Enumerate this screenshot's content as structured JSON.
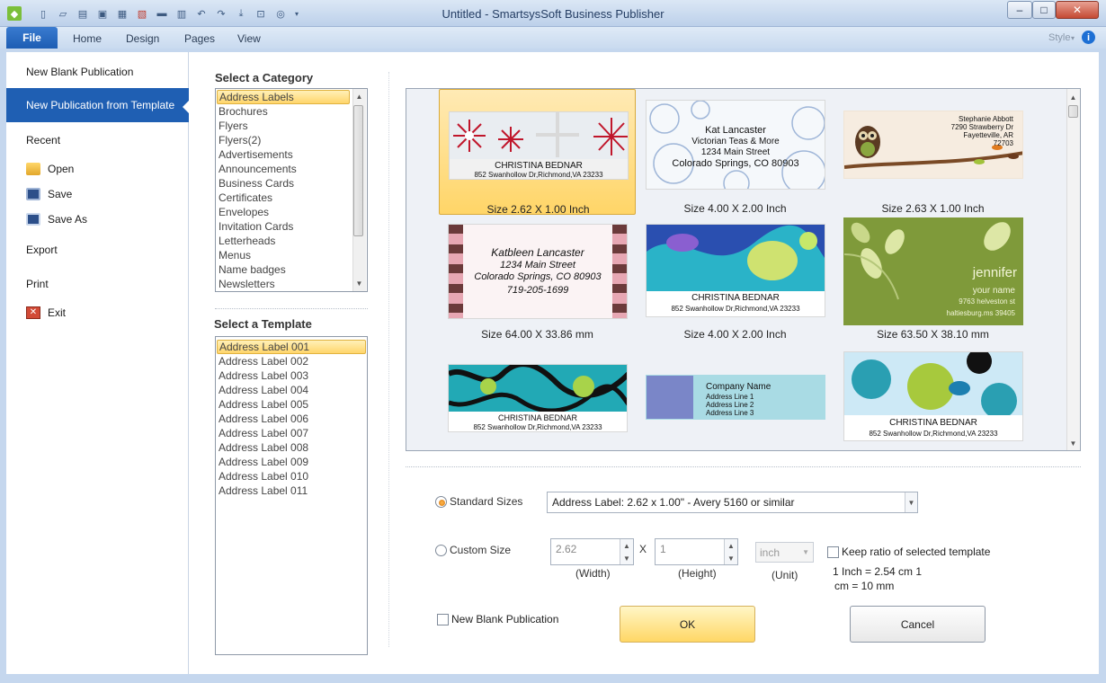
{
  "window": {
    "title": "Untitled - SmartsysSoft Business Publisher",
    "controls": {
      "minimize": "–",
      "maximize": "□",
      "close": "✕"
    }
  },
  "quick_access_icons": [
    "app-icon",
    "new-icon",
    "open-folder-icon",
    "open-icon",
    "save-icon",
    "pdf-icon",
    "scan-icon",
    "print-icon",
    "undo-icon",
    "redo-icon",
    "import-icon",
    "cart-icon",
    "help-icon",
    "customize-icon"
  ],
  "ribbon": {
    "file_tab": "File",
    "tabs": [
      "Home",
      "Design",
      "Pages",
      "View"
    ],
    "style_label": "Style",
    "info": "i"
  },
  "file_menu": {
    "new_blank": "New Blank Publication",
    "new_from_template": "New Publication from Template",
    "recent": "Recent",
    "open": "Open",
    "save": "Save",
    "save_as": "Save As",
    "export": "Export",
    "print": "Print",
    "exit": "Exit"
  },
  "category": {
    "heading": "Select a Category",
    "items": [
      "Address Labels",
      "Brochures",
      "Flyers",
      "Flyers(2)",
      "Advertisements",
      "Announcements",
      "Business Cards",
      "Certificates",
      "Envelopes",
      "Invitation Cards",
      "Letterheads",
      "Menus",
      "Name badges",
      "Newsletters"
    ]
  },
  "template": {
    "heading": "Select a Template",
    "items": [
      "Address Label 001",
      "Address Label 002",
      "Address Label 003",
      "Address Label 004",
      "Address Label 005",
      "Address Label 006",
      "Address Label 007",
      "Address Label 008",
      "Address Label 009",
      "Address Label 010",
      "Address Label 011"
    ]
  },
  "gallery": [
    {
      "size": "Size 2.62 X 1.00 Inch",
      "lines": [
        "CHRISTINA BEDNAR",
        "852 Swanhollow Dr,Richmond,VA 23233"
      ]
    },
    {
      "size": "Size 4.00 X 2.00 Inch",
      "lines": [
        "Kat Lancaster",
        "Victorian Teas & More",
        "1234 Main Street",
        "Colorado Springs, CO 80903"
      ]
    },
    {
      "size": "Size 2.63 X 1.00 Inch",
      "lines": [
        "Stephanie Abbott",
        "7290 Strawberry Dr",
        "Fayetteville, AR",
        "72703"
      ]
    },
    {
      "size": "Size 64.00 X 33.86 mm",
      "lines": [
        "Katbleen Lancaster",
        "1234 Main Street",
        "Colorado Springs, CO 80903",
        "719-205-1699"
      ]
    },
    {
      "size": "Size 4.00 X 2.00 Inch",
      "lines": [
        "CHRISTINA BEDNAR",
        "852 Swanhollow Dr,Richmond,VA 23233"
      ]
    },
    {
      "size": "Size 63.50 X 38.10 mm",
      "lines": [
        "jennifer",
        "your name",
        "9763 helveston st",
        "haltiesburg.ms 39405"
      ]
    },
    {
      "size": "",
      "lines": [
        "CHRISTINA BEDNAR",
        "852 Swanhollow Dr,Richmond,VA 23233"
      ]
    },
    {
      "size": "",
      "lines": [
        "Company Name",
        "Address Line 1",
        "Address Line 2",
        "Address Line 3"
      ]
    },
    {
      "size": "",
      "lines": [
        "CHRISTINA BEDNAR",
        "852 Swanhollow Dr,Richmond,VA 23233"
      ]
    }
  ],
  "options": {
    "standard_sizes_label": "Standard Sizes",
    "standard_sizes_value": "Address Label: 2.62 x 1.00\" - Avery 5160 or similar",
    "custom_size_label": "Custom Size",
    "width_value": "2.62",
    "x_label": "X",
    "height_value": "1",
    "unit_value": "inch",
    "width_caption": "(Width)",
    "height_caption": "(Height)",
    "unit_caption": "(Unit)",
    "keep_ratio_label": "Keep ratio of selected template",
    "conversion_line1": "1 Inch = 2.54 cm  1",
    "conversion_line2": "cm = 10 mm",
    "new_blank_label": "New Blank Publication",
    "ok_label": "OK",
    "cancel_label": "Cancel"
  }
}
